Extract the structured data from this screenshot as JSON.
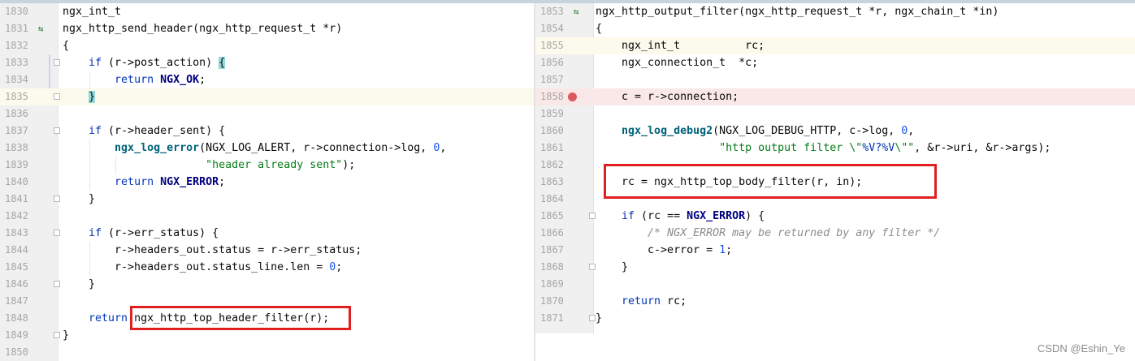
{
  "left": {
    "lines": [
      {
        "num": "1830",
        "code": [
          {
            "t": "ngx_int_t",
            "c": ""
          }
        ]
      },
      {
        "num": "1831",
        "mark": "⇆",
        "code": [
          {
            "t": "ngx_http_send_header(ngx_http_request_t *r)",
            "c": ""
          }
        ]
      },
      {
        "num": "1832",
        "code": [
          {
            "t": "{",
            "c": ""
          }
        ]
      },
      {
        "num": "1833",
        "fold": true,
        "code": [
          {
            "t": "    ",
            "c": ""
          },
          {
            "t": "if",
            "c": "kw"
          },
          {
            "t": " (r->post_action) ",
            "c": ""
          },
          {
            "t": "{",
            "c": "brace-hl"
          }
        ]
      },
      {
        "num": "1834",
        "code": [
          {
            "t": "        ",
            "c": ""
          },
          {
            "t": "return",
            "c": "kw"
          },
          {
            "t": " ",
            "c": ""
          },
          {
            "t": "NGX_OK",
            "c": "const"
          },
          {
            "t": ";",
            "c": ""
          }
        ]
      },
      {
        "num": "1835",
        "fold": true,
        "hl": true,
        "code": [
          {
            "t": "    ",
            "c": ""
          },
          {
            "t": "}",
            "c": "brace-hl"
          }
        ]
      },
      {
        "num": "1836",
        "code": []
      },
      {
        "num": "1837",
        "fold": true,
        "code": [
          {
            "t": "    ",
            "c": ""
          },
          {
            "t": "if",
            "c": "kw"
          },
          {
            "t": " (r->header_sent) {",
            "c": ""
          }
        ]
      },
      {
        "num": "1838",
        "code": [
          {
            "t": "        ",
            "c": ""
          },
          {
            "t": "ngx_log_error",
            "c": "fn"
          },
          {
            "t": "(NGX_LOG_ALERT, r->connection->log, ",
            "c": ""
          },
          {
            "t": "0",
            "c": "num"
          },
          {
            "t": ",",
            "c": ""
          }
        ]
      },
      {
        "num": "1839",
        "code": [
          {
            "t": "                      ",
            "c": ""
          },
          {
            "t": "\"header already sent\"",
            "c": "str"
          },
          {
            "t": ");",
            "c": ""
          }
        ]
      },
      {
        "num": "1840",
        "code": [
          {
            "t": "        ",
            "c": ""
          },
          {
            "t": "return",
            "c": "kw"
          },
          {
            "t": " ",
            "c": ""
          },
          {
            "t": "NGX_ERROR",
            "c": "const"
          },
          {
            "t": ";",
            "c": ""
          }
        ]
      },
      {
        "num": "1841",
        "fold": true,
        "code": [
          {
            "t": "    }",
            "c": ""
          }
        ]
      },
      {
        "num": "1842",
        "code": []
      },
      {
        "num": "1843",
        "fold": true,
        "code": [
          {
            "t": "    ",
            "c": ""
          },
          {
            "t": "if",
            "c": "kw"
          },
          {
            "t": " (r->err_status) {",
            "c": ""
          }
        ]
      },
      {
        "num": "1844",
        "code": [
          {
            "t": "        r->headers_out.status = r->err_status;",
            "c": ""
          }
        ]
      },
      {
        "num": "1845",
        "code": [
          {
            "t": "        r->headers_out.status_line.len = ",
            "c": ""
          },
          {
            "t": "0",
            "c": "num"
          },
          {
            "t": ";",
            "c": ""
          }
        ]
      },
      {
        "num": "1846",
        "fold": true,
        "code": [
          {
            "t": "    }",
            "c": ""
          }
        ]
      },
      {
        "num": "1847",
        "code": []
      },
      {
        "num": "1848",
        "code": [
          {
            "t": "    ",
            "c": ""
          },
          {
            "t": "return",
            "c": "kw"
          },
          {
            "t": " ngx_http_top_header_filter(r);",
            "c": ""
          }
        ]
      },
      {
        "num": "1849",
        "fold": true,
        "code": [
          {
            "t": "}",
            "c": ""
          }
        ]
      },
      {
        "num": "1850",
        "code": []
      }
    ]
  },
  "right": {
    "lines": [
      {
        "num": "1853",
        "mark": "⇆",
        "code": [
          {
            "t": "ngx_http_output_filter(ngx_http_request_t *r, ngx_chain_t *in)",
            "c": ""
          }
        ]
      },
      {
        "num": "1854",
        "code": [
          {
            "t": "{",
            "c": ""
          }
        ]
      },
      {
        "num": "1855",
        "hl": true,
        "code": [
          {
            "t": "    ngx_int_t          rc;",
            "c": ""
          }
        ]
      },
      {
        "num": "1856",
        "code": [
          {
            "t": "    ngx_connection_t  *c;",
            "c": ""
          }
        ]
      },
      {
        "num": "1857",
        "code": []
      },
      {
        "num": "1858",
        "bp": true,
        "code": [
          {
            "t": "    c = r->connection;",
            "c": ""
          }
        ]
      },
      {
        "num": "1859",
        "code": []
      },
      {
        "num": "1860",
        "code": [
          {
            "t": "    ",
            "c": ""
          },
          {
            "t": "ngx_log_debug2",
            "c": "fn"
          },
          {
            "t": "(NGX_LOG_DEBUG_HTTP, c->log, ",
            "c": ""
          },
          {
            "t": "0",
            "c": "num"
          },
          {
            "t": ",",
            "c": ""
          }
        ]
      },
      {
        "num": "1861",
        "code": [
          {
            "t": "                   ",
            "c": ""
          },
          {
            "t": "\"http output filter \\\"",
            "c": "str"
          },
          {
            "t": "%V?%V",
            "c": "kw"
          },
          {
            "t": "\\\"\"",
            "c": "str"
          },
          {
            "t": ", &r->uri, &r->args);",
            "c": ""
          }
        ]
      },
      {
        "num": "1862",
        "code": []
      },
      {
        "num": "1863",
        "code": [
          {
            "t": "    rc = ngx_http_top_body_filter(r, in);",
            "c": ""
          }
        ]
      },
      {
        "num": "1864",
        "code": []
      },
      {
        "num": "1865",
        "fold": true,
        "code": [
          {
            "t": "    ",
            "c": ""
          },
          {
            "t": "if",
            "c": "kw"
          },
          {
            "t": " (rc == ",
            "c": ""
          },
          {
            "t": "NGX_ERROR",
            "c": "const"
          },
          {
            "t": ") {",
            "c": ""
          }
        ]
      },
      {
        "num": "1866",
        "code": [
          {
            "t": "        ",
            "c": ""
          },
          {
            "t": "/* NGX_ERROR may be returned by any filter */",
            "c": "cmt"
          }
        ]
      },
      {
        "num": "1867",
        "code": [
          {
            "t": "        c->error = ",
            "c": ""
          },
          {
            "t": "1",
            "c": "num"
          },
          {
            "t": ";",
            "c": ""
          }
        ]
      },
      {
        "num": "1868",
        "fold": true,
        "code": [
          {
            "t": "    }",
            "c": ""
          }
        ]
      },
      {
        "num": "1869",
        "code": []
      },
      {
        "num": "1870",
        "code": [
          {
            "t": "    ",
            "c": ""
          },
          {
            "t": "return",
            "c": "kw"
          },
          {
            "t": " rc;",
            "c": ""
          }
        ]
      },
      {
        "num": "1871",
        "fold": true,
        "code": [
          {
            "t": "}",
            "c": ""
          }
        ]
      }
    ]
  },
  "watermark": "CSDN @Eshin_Ye",
  "colors": {
    "highlight_box": "#e02020",
    "breakpoint": "#db5860"
  }
}
